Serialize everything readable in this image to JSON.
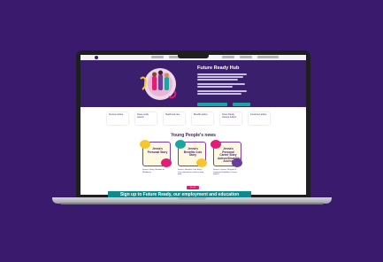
{
  "hero": {
    "title": "Future Ready Hub"
  },
  "tiles": [
    {
      "label": "Success stories"
    },
    {
      "label": "Future ready careers"
    },
    {
      "label": "Health and care"
    },
    {
      "label": "Benefits advice"
    },
    {
      "label": "Future Ready Careers Advisor"
    },
    {
      "label": "Investment advice"
    }
  ],
  "news": {
    "title": "Young People's news",
    "cards": [
      {
        "title": "Jenna's Personal Story",
        "caption": "Jenna's Story: Benefits to Wellbeing"
      },
      {
        "title": "Jenna's Benefits Cuts Story",
        "caption": "Jenna's Benefits Cuts Story: Cuts affected her and her way back"
      },
      {
        "title": "Jenna's Personal Career Story Autism/Disability Access",
        "caption": "Jenna's Career: Physical & Learning Disabilities Career Impact"
      }
    ],
    "see_all": "See all"
  },
  "signup": {
    "label": "Sign up to Future Ready, our employment and education"
  },
  "colors": {
    "background": "#3a1a6c",
    "hero": "#3a1f6d",
    "accent_teal": "#0e8a8b",
    "accent_pink": "#e11d74"
  }
}
